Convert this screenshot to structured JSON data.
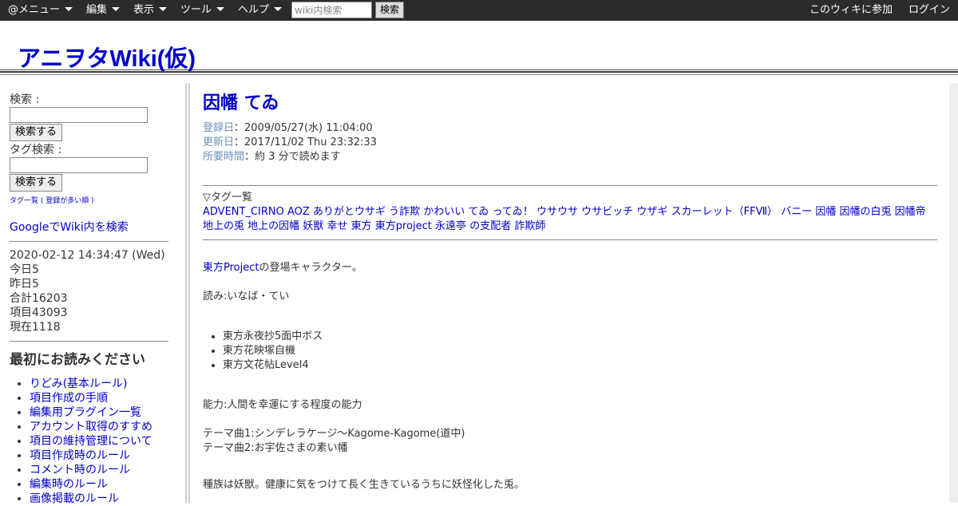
{
  "topbar": {
    "menus": [
      "@メニュー",
      "編集",
      "表示",
      "ツール",
      "ヘルプ"
    ],
    "search_placeholder": "wiki内検索",
    "search_button": "検索",
    "join": "このウィキに参加",
    "login": "ログイン"
  },
  "site_title": "アニヲタWiki(仮)",
  "left": {
    "search_label": "検索 :",
    "search_button": "検索する",
    "tag_search_label": "タグ検索 :",
    "tag_search_button": "検索する",
    "tag_list": "タグ一覧",
    "tag_popular": "登録が多い順",
    "google_search": "GoogleでWiki内を検索",
    "datetime": "2020-02-12 14:34:47 (Wed)",
    "today": "今日5",
    "yesterday": "昨日5",
    "total": "合計16203",
    "items": "項目43093",
    "now": "現在1118",
    "read_first_heading": "最初にお読みください",
    "read_first_items": [
      "りどみ(基本ルール)",
      "項目作成の手順",
      "編集用プラグイン一覧",
      "アカウント取得のすすめ",
      "項目の維持管理について",
      "項目作成時のルール",
      "コメント時のルール",
      "編集時のルール",
      "画像掲載のルール"
    ]
  },
  "article": {
    "title": "因幡 てゐ",
    "registered_label": "登録日",
    "registered": "2009/05/27(水) 11:04:00",
    "updated_label": "更新日",
    "updated": "2017/11/02 Thu 23:32:33",
    "time_label": "所要時間",
    "time": "約 3 分で読めます",
    "tag_header": "▽タグ一覧",
    "tags": [
      "ADVENT_CIRNO",
      "AOZ",
      "ありがとウサギ",
      "う詐欺",
      "かわいい",
      "てゐ",
      "ってゐ！",
      "ウサウサ",
      "ウサビッチ",
      "ウザギ",
      "スカーレット（FFⅦ）",
      "バニー",
      "因幡",
      "因幡の白兎",
      "因幡帝",
      "地上の兎",
      "地上の因幡",
      "妖獣",
      "幸せ",
      "東方",
      "東方project",
      "永遠亭",
      "の支配者",
      "詐欺師"
    ],
    "intro_link": "東方Project",
    "intro_rest": "の登場キャラクター。",
    "reading": "読み:いなば・てい",
    "appearances": [
      "東方永夜抄5面中ボス",
      "東方花映塚自機",
      "東方文花帖Level4"
    ],
    "ability": "能力:人間を幸運にする程度の能力",
    "theme1": "テーマ曲1:シンデレラケージ～Kagome-Kagome(道中)",
    "theme2": "テーマ曲2:お宇佐さまの素い幡",
    "species": "種族は妖獣。健康に気をつけて長く生きているうちに妖怪化した兎。"
  }
}
